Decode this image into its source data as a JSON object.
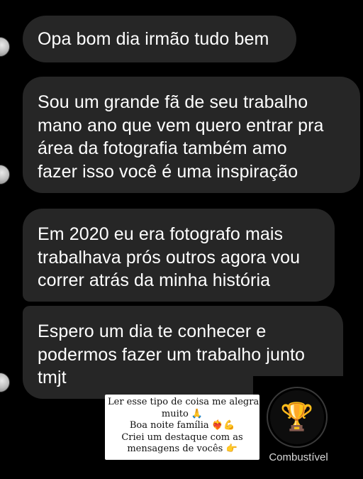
{
  "messages": [
    {
      "id": "b1",
      "text": "Opa bom dia irmão tudo bem"
    },
    {
      "id": "b2",
      "text": "Sou um grande fã de seu trabalho\nmano ano que vem quero entrar pra\nárea da fotografia também amo\nfazer isso você é uma inspiração"
    },
    {
      "id": "b3",
      "text": "Em 2020 eu era fotografo mais\ntrabalhava prós outros agora vou\ncorrer atrás da minha história"
    },
    {
      "id": "b4",
      "text": "Espero um dia te conhecer e\npodermos fazer um trabalho junto\ntmjt"
    }
  ],
  "caption": {
    "line1": "Ler esse tipo de coisa me alegra",
    "line2": "muito 🙏",
    "line3": "Boa noite família ❤️‍🔥💪",
    "line4": "Criei um destaque com as",
    "line5": "mensagens de vocês 👉"
  },
  "highlight": {
    "icon": "trophy-icon",
    "emoji": "🏆",
    "label": "Combustível"
  }
}
